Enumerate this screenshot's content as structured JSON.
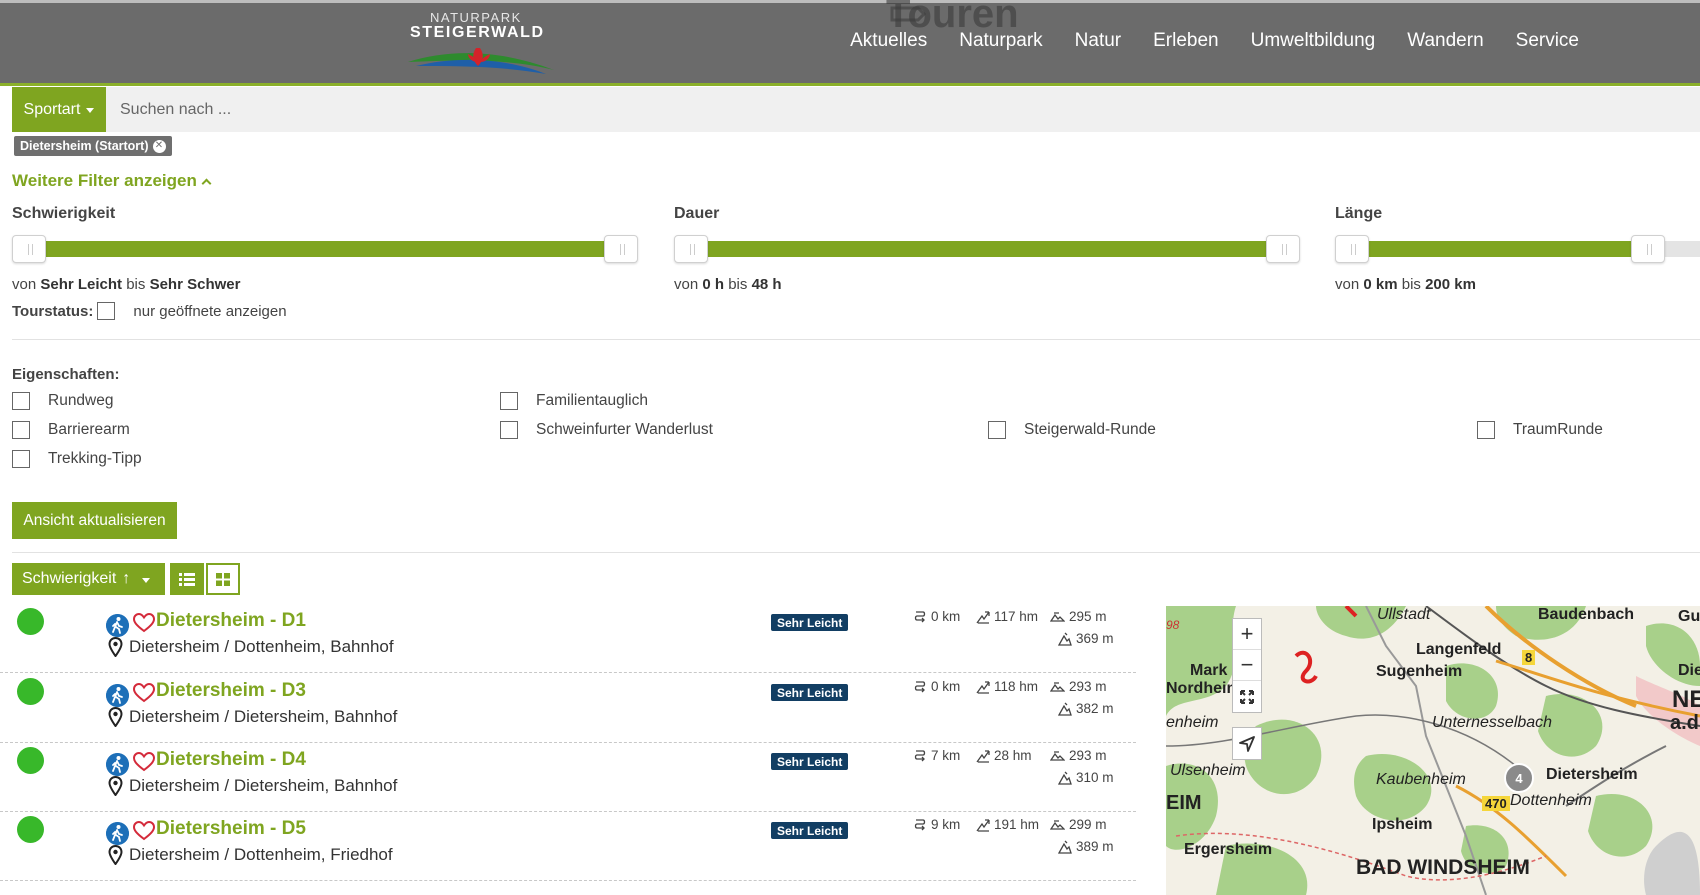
{
  "header": {
    "logo_small": "NATURPARK",
    "logo_big": "STEIGERWALD",
    "ghost_title": "Touren",
    "nav": [
      "Aktuelles",
      "Naturpark",
      "Natur",
      "Erleben",
      "Umweltbildung",
      "Wandern",
      "Service"
    ]
  },
  "search": {
    "sport_label": "Sportart",
    "placeholder": "Suchen nach ..."
  },
  "active_filter_tag": "Dietersheim (Startort)",
  "more_filters_label": "Weitere Filter anzeigen",
  "filters": {
    "difficulty": {
      "label": "Schwierigkeit",
      "prefix": "von",
      "from": "Sehr Leicht",
      "mid": "bis",
      "to": "Sehr Schwer"
    },
    "duration": {
      "label": "Dauer",
      "prefix": "von",
      "from": "0 h",
      "mid": "bis",
      "to": "48 h"
    },
    "length": {
      "label": "Länge",
      "prefix": "von",
      "from": "0 km",
      "mid": "bis",
      "to": "200 km"
    }
  },
  "tourstatus": {
    "label": "Tourstatus:",
    "option": "nur geöffnete anzeigen"
  },
  "properties": {
    "label": "Eigenschaften:",
    "items": [
      "Rundweg",
      "Familientauglich",
      "Barrierearm",
      "Schweinfurter Wanderlust",
      "Steigerwald-Runde",
      "TraumRunde",
      "Trekking-Tipp"
    ]
  },
  "update_button": "Ansicht aktualisieren",
  "sort": {
    "label": "Schwierigkeit",
    "arrow": "↑"
  },
  "tours": [
    {
      "title": "Dietersheim - D1",
      "location": "Dietersheim / Dottenheim, Bahnhof",
      "difficulty": "Sehr Leicht",
      "distance": "0 km",
      "ascent": "117 hm",
      "max_alt": "295 m",
      "min_alt": "369 m"
    },
    {
      "title": "Dietersheim - D3",
      "location": "Dietersheim / Dietersheim, Bahnhof",
      "difficulty": "Sehr Leicht",
      "distance": "0 km",
      "ascent": "118 hm",
      "max_alt": "293 m",
      "min_alt": "382 m"
    },
    {
      "title": "Dietersheim - D4",
      "location": "Dietersheim / Dietersheim, Bahnhof",
      "difficulty": "Sehr Leicht",
      "distance": "7 km",
      "ascent": "28 hm",
      "max_alt": "293 m",
      "min_alt": "310 m"
    },
    {
      "title": "Dietersheim - D5",
      "location": "Dietersheim / Dottenheim, Friedhof",
      "difficulty": "Sehr Leicht",
      "distance": "9 km",
      "ascent": "191 hm",
      "max_alt": "299 m",
      "min_alt": "389 m"
    }
  ],
  "map": {
    "zoom_in": "+",
    "zoom_out": "−",
    "cluster_count": "4",
    "labels": [
      "Ullstadt",
      "Baudenbach",
      "Gu",
      "Mark",
      "Nordheim",
      "Langenfeld",
      "Sugenheim",
      "Die",
      "NE",
      "a.d.",
      "enheim",
      "Unternesselbach",
      "Ulsenheim",
      "Kaubenheim",
      "Dietersheim",
      "EIM",
      "Dottenheim",
      "Ipsheim",
      "Ergersheim",
      "BAD WINDSHEIM",
      "98",
      "8",
      "470"
    ]
  },
  "colors": {
    "green": "#7fa520",
    "header": "#6b6b6b",
    "badge": "#123e63",
    "status": "#38b82a",
    "hike": "#1d6fb8"
  }
}
